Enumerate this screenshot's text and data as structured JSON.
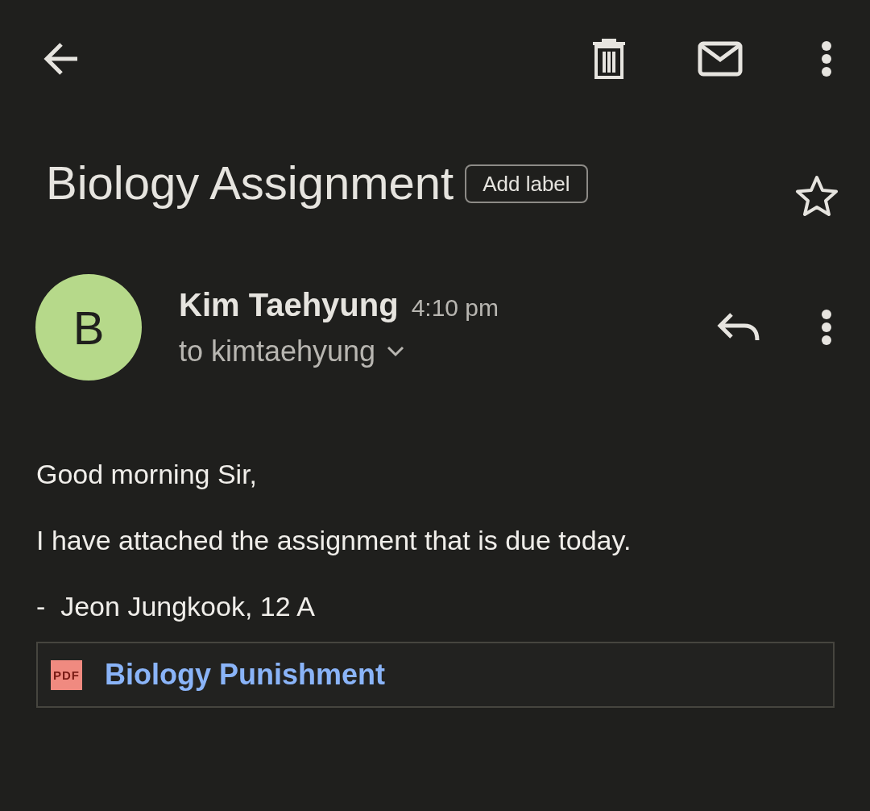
{
  "subject": {
    "title": "Biology Assignment",
    "label_button": "Add label",
    "starred": false
  },
  "message": {
    "avatar_letter": "B",
    "sender": "Kim Taehyung",
    "time": "4:10 pm",
    "recipient": "to kimtaehyung",
    "body": [
      "Good morning Sir,",
      "I have attached the assignment that is due today.",
      "-  Jeon Jungkook, 12 A"
    ],
    "attachment": {
      "type_label": "PDF",
      "name": "Biology Punishment"
    }
  }
}
